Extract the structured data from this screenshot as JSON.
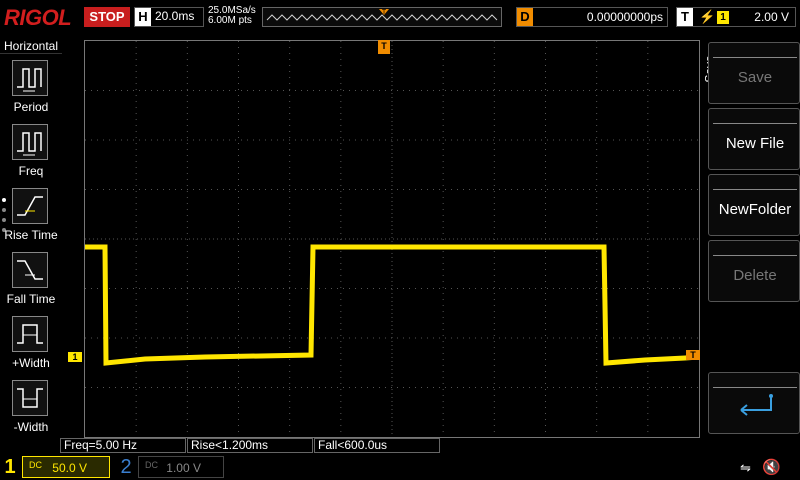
{
  "header": {
    "brand": "RIGOL",
    "run_state": "STOP",
    "horizontal_label": "H",
    "timebase": "20.0ms",
    "sample_rate": "25.0MSa/s",
    "memory_depth": "6.00M pts",
    "delay_label": "D",
    "delay_value": "0.00000000ps",
    "trigger_label": "T",
    "trigger_edge": "⚡",
    "trigger_channel": "1",
    "trigger_level": "2.00 V"
  },
  "left_menu": {
    "title": "Horizontal",
    "items": [
      {
        "label": "Period",
        "icon": "period-icon"
      },
      {
        "label": "Freq",
        "icon": "freq-icon"
      },
      {
        "label": "Rise Time",
        "icon": "rise-time-icon"
      },
      {
        "label": "Fall Time",
        "icon": "fall-time-icon"
      },
      {
        "label": "+Width",
        "icon": "positive-width-icon"
      },
      {
        "label": "-Width",
        "icon": "negative-width-icon"
      }
    ]
  },
  "right_menu": {
    "side_label": "Save",
    "buttons": [
      {
        "label": "Save",
        "enabled": false
      },
      {
        "label": "New File",
        "enabled": true
      },
      {
        "label": "NewFolder",
        "enabled": true
      },
      {
        "label": "Delete",
        "enabled": false
      },
      {
        "label": "",
        "icon": "return-arrow-icon",
        "enabled": true
      }
    ]
  },
  "measurements": {
    "freq": "Freq=5.00 Hz",
    "rise": "Rise<1.200ms",
    "fall": "Fall<600.0us"
  },
  "channels": {
    "ch1_number": "1",
    "ch1_coupling": "DC",
    "ch1_scale": "50.0 V",
    "ch2_number": "2",
    "ch2_coupling": "DC",
    "ch2_scale": "1.00 V"
  },
  "markers": {
    "ch1_marker": "1",
    "trigger_marker": "T"
  },
  "colors": {
    "brand": "#d21e1e",
    "ch1": "#ffe600",
    "ch2": "#3a7fd0",
    "trigger": "#f08c00",
    "grid": "#555555"
  }
}
